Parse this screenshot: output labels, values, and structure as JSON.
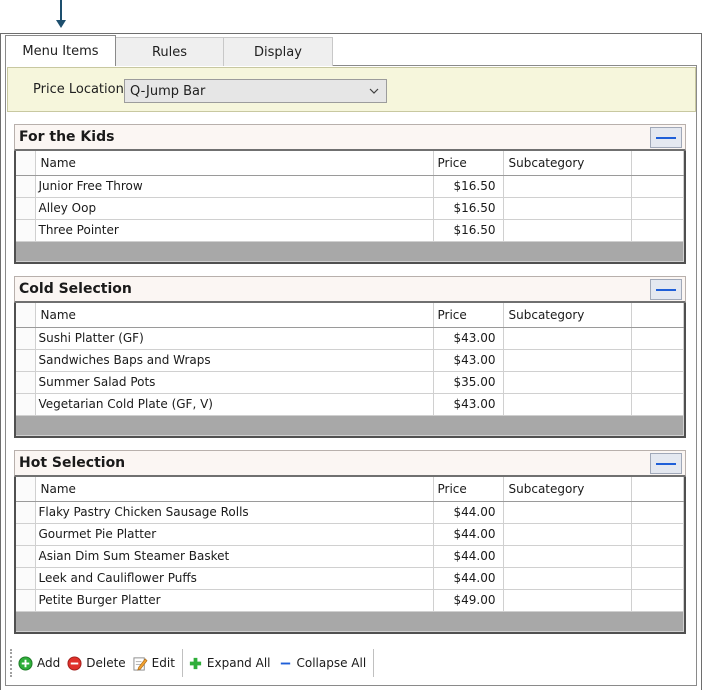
{
  "tabs": [
    {
      "label": "Menu Items",
      "active": true
    },
    {
      "label": "Rules",
      "active": false
    },
    {
      "label": "Display",
      "active": false
    }
  ],
  "price_location": {
    "label": "Price Location",
    "selected": "Q-Jump Bar"
  },
  "columns": {
    "name": "Name",
    "price": "Price",
    "subcategory": "Subcategory"
  },
  "sections": [
    {
      "title": "For the Kids",
      "rows": [
        {
          "name": "Junior Free Throw",
          "price": "$16.50",
          "subcategory": ""
        },
        {
          "name": "Alley Oop",
          "price": "$16.50",
          "subcategory": ""
        },
        {
          "name": "Three Pointer",
          "price": "$16.50",
          "subcategory": ""
        }
      ]
    },
    {
      "title": "Cold Selection",
      "rows": [
        {
          "name": "Sushi Platter (GF)",
          "price": "$43.00",
          "subcategory": ""
        },
        {
          "name": "Sandwiches Baps and Wraps",
          "price": "$43.00",
          "subcategory": ""
        },
        {
          "name": "Summer Salad Pots",
          "price": "$35.00",
          "subcategory": ""
        },
        {
          "name": "Vegetarian Cold Plate (GF, V)",
          "price": "$43.00",
          "subcategory": ""
        }
      ]
    },
    {
      "title": "Hot Selection",
      "rows": [
        {
          "name": "Flaky Pastry Chicken Sausage Rolls",
          "price": "$44.00",
          "subcategory": ""
        },
        {
          "name": "Gourmet Pie Platter",
          "price": "$44.00",
          "subcategory": ""
        },
        {
          "name": "Asian Dim Sum Steamer Basket",
          "price": "$44.00",
          "subcategory": ""
        },
        {
          "name": "Leek and Cauliflower Puffs",
          "price": "$44.00",
          "subcategory": ""
        },
        {
          "name": "Petite Burger Platter",
          "price": "$49.00",
          "subcategory": ""
        }
      ]
    }
  ],
  "toolbar": {
    "add": "Add",
    "delete": "Delete",
    "edit": "Edit",
    "expand_all": "Expand All",
    "collapse_all": "Collapse All"
  },
  "colors": {
    "price_bar_bg": "#f6f6dc",
    "collapse_accent": "#1f5fd8",
    "add_green": "#2fae3a",
    "delete_red": "#e0302a"
  },
  "icons": {
    "add": "add-icon",
    "delete": "delete-icon",
    "edit": "edit-icon",
    "expand_all": "expand-all-icon",
    "collapse_all": "collapse-all-icon",
    "section_collapse": "collapse-icon",
    "dropdown": "chevron-down-icon"
  }
}
